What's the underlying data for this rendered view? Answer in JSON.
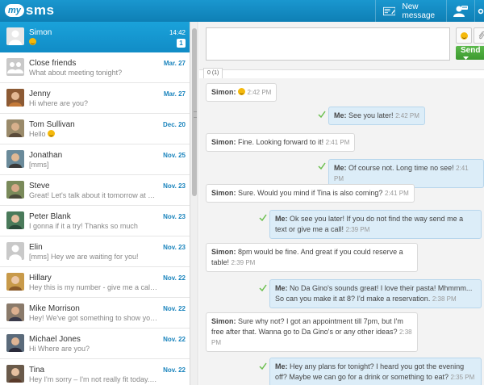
{
  "app": {
    "logo_my": "my",
    "logo_sms": "sms"
  },
  "topbar": {
    "new_message": "New message"
  },
  "conversations": [
    {
      "name": "Simon",
      "preview": "",
      "preview_emoji": true,
      "date": "14:42",
      "count": "1",
      "active": true
    },
    {
      "name": "Close friends",
      "preview": "What about meeting tonight?",
      "date": "Mar. 27"
    },
    {
      "name": "Jenny",
      "preview": "Hi where are you?",
      "date": "Mar. 27"
    },
    {
      "name": "Tom Sullivan",
      "preview": "Hello",
      "preview_emoji": true,
      "date": "Dec. 20"
    },
    {
      "name": "Jonathan",
      "preview": "[mms]",
      "date": "Nov. 25"
    },
    {
      "name": "Steve",
      "preview": "Great! Let's talk about it tomorrow at Flan'...",
      "date": "Nov. 23"
    },
    {
      "name": "Peter Blank",
      "preview": "I gonna if it a try! Thanks so much",
      "date": "Nov. 23"
    },
    {
      "name": "Elin",
      "preview": "[mms] Hey we are waiting for you!",
      "date": "Nov. 23"
    },
    {
      "name": "Hillary",
      "preview": "Hey this is my number - give me a call if yo...",
      "date": "Nov. 22"
    },
    {
      "name": "Mike Morrison",
      "preview": "Hey! We've got something to show you! ht...",
      "date": "Nov. 22"
    },
    {
      "name": "Michael Jones",
      "preview": "Hi Where are you?",
      "date": "Nov. 22"
    },
    {
      "name": "Tina",
      "preview": "Hey I'm sorry – I'm not really fit today. I gu...",
      "date": "Nov. 22"
    }
  ],
  "compose": {
    "placeholder": "",
    "send_label": "Send",
    "counter": "0 (1)"
  },
  "messages": [
    {
      "dir": "in",
      "sender": "Simon:",
      "text": "",
      "emoji": true,
      "time": "2:42 PM"
    },
    {
      "dir": "out",
      "sender": "Me:",
      "text": "See you later!",
      "time": "2:42 PM"
    },
    {
      "dir": "in",
      "sender": "Simon:",
      "text": "Fine. Looking forward to it!",
      "time": "2:41 PM"
    },
    {
      "dir": "out",
      "sender": "Me:",
      "text": "Of course not. Long time no see!",
      "time": "2:41 PM"
    },
    {
      "dir": "in",
      "sender": "Simon:",
      "text": "Sure. Would you mind if Tina is also coming?",
      "time": "2:41 PM"
    },
    {
      "dir": "out",
      "sender": "Me:",
      "text": "Ok see you later! If you do not find the way send me a text or give me a call!",
      "time": "2:39 PM"
    },
    {
      "dir": "in",
      "sender": "Simon:",
      "text": "8pm would be fine. And great if you could reserve a table!",
      "time": "2:39 PM"
    },
    {
      "dir": "out",
      "sender": "Me:",
      "text": "No Da Gino's sounds great! I love their pasta! Mhmmm... So can you make it at 8? I'd make a reservation.",
      "time": "2:38 PM"
    },
    {
      "dir": "in",
      "sender": "Simon:",
      "text": "Sure why not? I got an appointment till 7pm, but I'm free after that. Wanna go to Da Gino's or any other ideas?",
      "time": "2:38 PM"
    },
    {
      "dir": "out",
      "sender": "Me:",
      "text": "Hey any plans for tonight? I heard you got the evening off? Maybe we can go for a drink or something to eat?",
      "time": "2:35 PM"
    }
  ]
}
